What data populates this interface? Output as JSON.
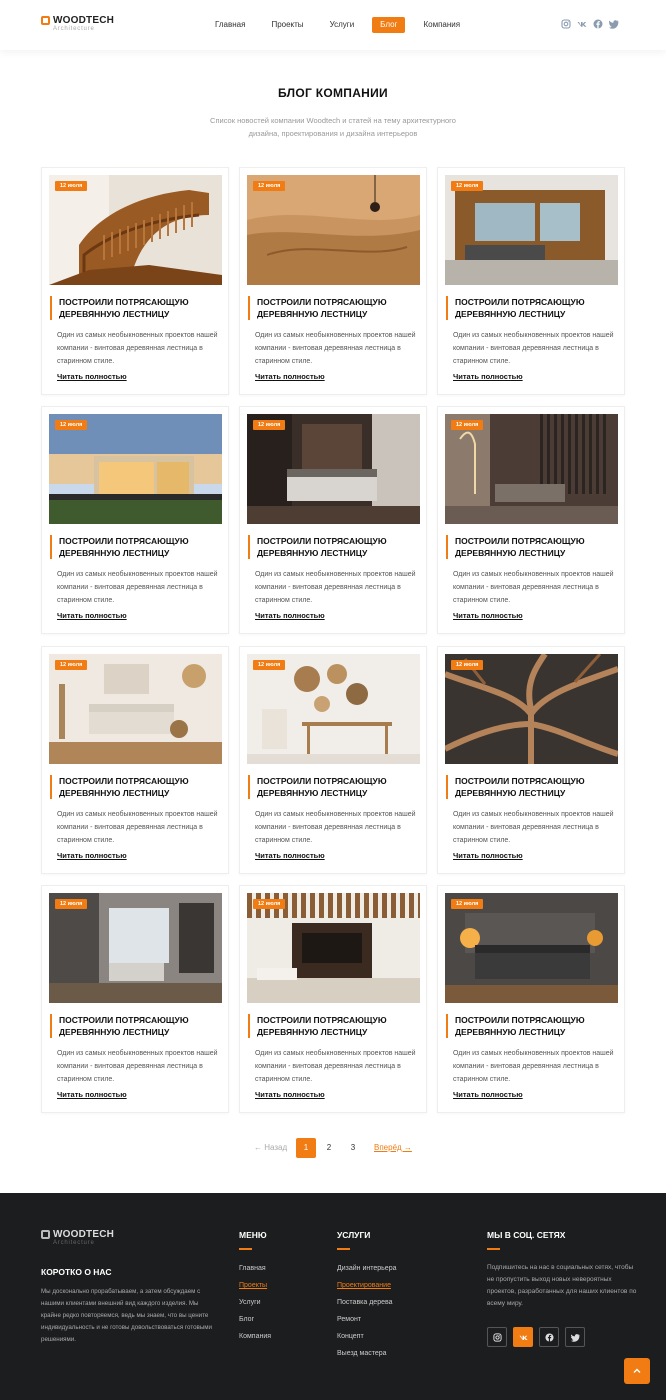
{
  "brand": {
    "name": "WOODTECH",
    "tagline": "Architecture"
  },
  "nav": {
    "items": [
      {
        "label": "Главная",
        "active": false
      },
      {
        "label": "Проекты",
        "active": false
      },
      {
        "label": "Услуги",
        "active": false
      },
      {
        "label": "Блог",
        "active": true
      },
      {
        "label": "Компания",
        "active": false
      }
    ]
  },
  "header_socials": [
    "instagram-icon",
    "vk-icon",
    "facebook-icon",
    "twitter-icon"
  ],
  "page": {
    "title": "БЛОГ КОМПАНИИ",
    "subtitle": "Список новостей компании Woodtech и статей на тему архитектурного дизайна, проектирования и дизайна интерьеров"
  },
  "posts": [
    {
      "date": "12 июля",
      "title": "ПОСТРОИЛИ ПОТРЯСАЮЩУЮ ДЕРЕВЯННУЮ ЛЕСТНИЦУ",
      "text": "Один из самых необыкновенных проектов нашей компании - винтовая деревянная лестница в старинном стиле.",
      "link": "Читать полностью",
      "image": "carved wooden staircase"
    },
    {
      "date": "12 июля",
      "title": "ПОСТРОИЛИ ПОТРЯСАЮЩУЮ ДЕРЕВЯННУЮ ЛЕСТНИЦУ",
      "text": "Один из самых необыкновенных проектов нашей компании - винтовая деревянная лестница в старинном стиле.",
      "link": "Читать полностью",
      "image": "curved wooden interior"
    },
    {
      "date": "12 июля",
      "title": "ПОСТРОИЛИ ПОТРЯСАЮЩУЮ ДЕРЕВЯННУЮ ЛЕСТНИЦУ",
      "text": "Один из самых необыкновенных проектов нашей компании - винтовая деревянная лестница в старинном стиле.",
      "link": "Читать полностью",
      "image": "wooden niche living room"
    },
    {
      "date": "12 июля",
      "title": "ПОСТРОИЛИ ПОТРЯСАЮЩУЮ ДЕРЕВЯННУЮ ЛЕСТНИЦУ",
      "text": "Один из самых необыкновенных проектов нашей компании - винтовая деревянная лестница в старинном стиле.",
      "link": "Читать полностью",
      "image": "glass cabin at sunset"
    },
    {
      "date": "12 июля",
      "title": "ПОСТРОИЛИ ПОТРЯСАЮЩУЮ ДЕРЕВЯННУЮ ЛЕСТНИЦУ",
      "text": "Один из самых необыкновенных проектов нашей компании - винтовая деревянная лестница в старинном стиле.",
      "link": "Читать полностью",
      "image": "dark bedroom"
    },
    {
      "date": "12 июля",
      "title": "ПОСТРОИЛИ ПОТРЯСАЮЩУЮ ДЕРЕВЯННУЮ ЛЕСТНИЦУ",
      "text": "Один из самых необыкновенных проектов нашей компании - винтовая деревянная лестница в старинном стиле.",
      "link": "Читать полностью",
      "image": "slatted room divider interior"
    },
    {
      "date": "12 июля",
      "title": "ПОСТРОИЛИ ПОТРЯСАЮЩУЮ ДЕРЕВЯННУЮ ЛЕСТНИЦУ",
      "text": "Один из самых необыкновенных проектов нашей компании - винтовая деревянная лестница в старинном стиле.",
      "link": "Читать полностью",
      "image": "boho living room sofa"
    },
    {
      "date": "12 июля",
      "title": "ПОСТРОИЛИ ПОТРЯСАЮЩУЮ ДЕРЕВЯННУЮ ЛЕСТНИЦУ",
      "text": "Один из самых необыкновенных проектов нашей компании - винтовая деревянная лестница в старинном стиле.",
      "link": "Читать полностью",
      "image": "wall baskets console table"
    },
    {
      "date": "12 июля",
      "title": "ПОСТРОИЛИ ПОТРЯСАЮЩУЮ ДЕРЕВЯННУЮ ЛЕСТНИЦУ",
      "text": "Один из самых необыкновенных проектов нашей компании - винтовая деревянная лестница в старинном стиле.",
      "link": "Читать полностью",
      "image": "wooden tree sculpture"
    },
    {
      "date": "12 июля",
      "title": "ПОСТРОИЛИ ПОТРЯСАЮЩУЮ ДЕРЕВЯННУЮ ЛЕСТНИЦУ",
      "text": "Один из самых необыкновенных проектов нашей компании - винтовая деревянная лестница в старинном стиле.",
      "link": "Читать полностью",
      "image": "modern grey living room"
    },
    {
      "date": "12 июля",
      "title": "ПОСТРОИЛИ ПОТРЯСАЮЩУЮ ДЕРЕВЯННУЮ ЛЕСТНИЦУ",
      "text": "Один из самых необыкновенных проектов нашей компании - винтовая деревянная лестница в старинном стиле.",
      "link": "Читать полностью",
      "image": "wood slat ceiling living room"
    },
    {
      "date": "12 июля",
      "title": "ПОСТРОИЛИ ПОТРЯСАЮЩУЮ ДЕРЕВЯННУЮ ЛЕСТНИЦУ",
      "text": "Один из самых необыкновенных проектов нашей компании - винтовая деревянная лестница в старинном стиле.",
      "link": "Читать полностью",
      "image": "concrete bedroom with lamps"
    }
  ],
  "pagination": {
    "prev": "← Назад",
    "pages": [
      "1",
      "2",
      "3"
    ],
    "current": "1",
    "next": "Вперёд →"
  },
  "footer": {
    "about": {
      "title": "КОРОТКО О НАС",
      "text": "Мы досконально прорабатываем, а затем обсуждаем с нашими клиентами внешний вид каждого изделия. Мы крайне редко повторяемся, ведь мы знаем, что вы цените индивидуальность и не готовы довольствоваться готовыми решениями."
    },
    "menu": {
      "title": "МЕНЮ",
      "items": [
        "Главная",
        "Проекты",
        "Услуги",
        "Блог",
        "Компания"
      ],
      "highlighted": "Проекты"
    },
    "services": {
      "title": "УСЛУГИ",
      "items": [
        "Дизайн интерьера",
        "Проектирование",
        "Поставка дерева",
        "Ремонт",
        "Концепт",
        "Выезд мастера"
      ],
      "highlighted": "Проектирование"
    },
    "social": {
      "title": "МЫ В СОЦ. СЕТЯХ",
      "text": "Подпишитесь на нас в социальных сетях, чтобы не пропустить выход новых невероятных проектов, разработанных для наших клиентов по всему миру.",
      "icons": [
        "instagram-icon",
        "vk-icon",
        "facebook-icon",
        "twitter-icon"
      ],
      "active_icon": "vk-icon"
    }
  },
  "colors": {
    "accent": "#f07c13",
    "footer_bg": "#1b1d1e",
    "text": "#222222"
  }
}
